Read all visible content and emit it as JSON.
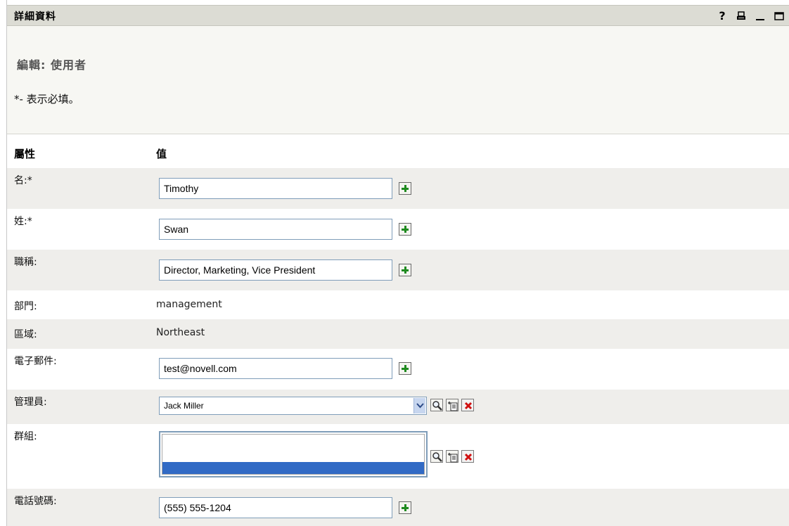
{
  "portlet": {
    "title": "詳細資料",
    "help_icon_glyph": "?"
  },
  "header": {
    "edit_title": "編輯: 使用者",
    "required_note": "*- 表示必填。"
  },
  "table": {
    "col_attribute": "屬性",
    "col_value": "值"
  },
  "fields": {
    "first_name": {
      "label": "名:*",
      "value": "Timothy"
    },
    "last_name": {
      "label": "姓:*",
      "value": "Swan"
    },
    "title": {
      "label": "職稱:",
      "value": "Director, Marketing, Vice President"
    },
    "department": {
      "label": "部門:",
      "value": "management"
    },
    "region": {
      "label": "區域:",
      "value": "Northeast"
    },
    "email": {
      "label": "電子郵件:",
      "value": "test@novell.com"
    },
    "manager": {
      "label": "管理員:",
      "value": "Jack Miller"
    },
    "group": {
      "label": "群組:"
    },
    "phone": {
      "label": "電話號碼:",
      "value": "(555) 555-1204"
    }
  },
  "icons": {
    "add": "plus-icon",
    "lookup": "magnifier-icon",
    "history": "history-icon",
    "delete": "delete-icon",
    "print": "print-icon",
    "minimize": "minimize-icon",
    "maximize": "maximize-icon"
  },
  "colors": {
    "titlebar": "#dcdcd4",
    "row_shade": "#efeeeb",
    "input_border": "#7f9db9",
    "selection": "#316ac5",
    "add_green": "#1f8a1f",
    "delete_red": "#d01010"
  }
}
